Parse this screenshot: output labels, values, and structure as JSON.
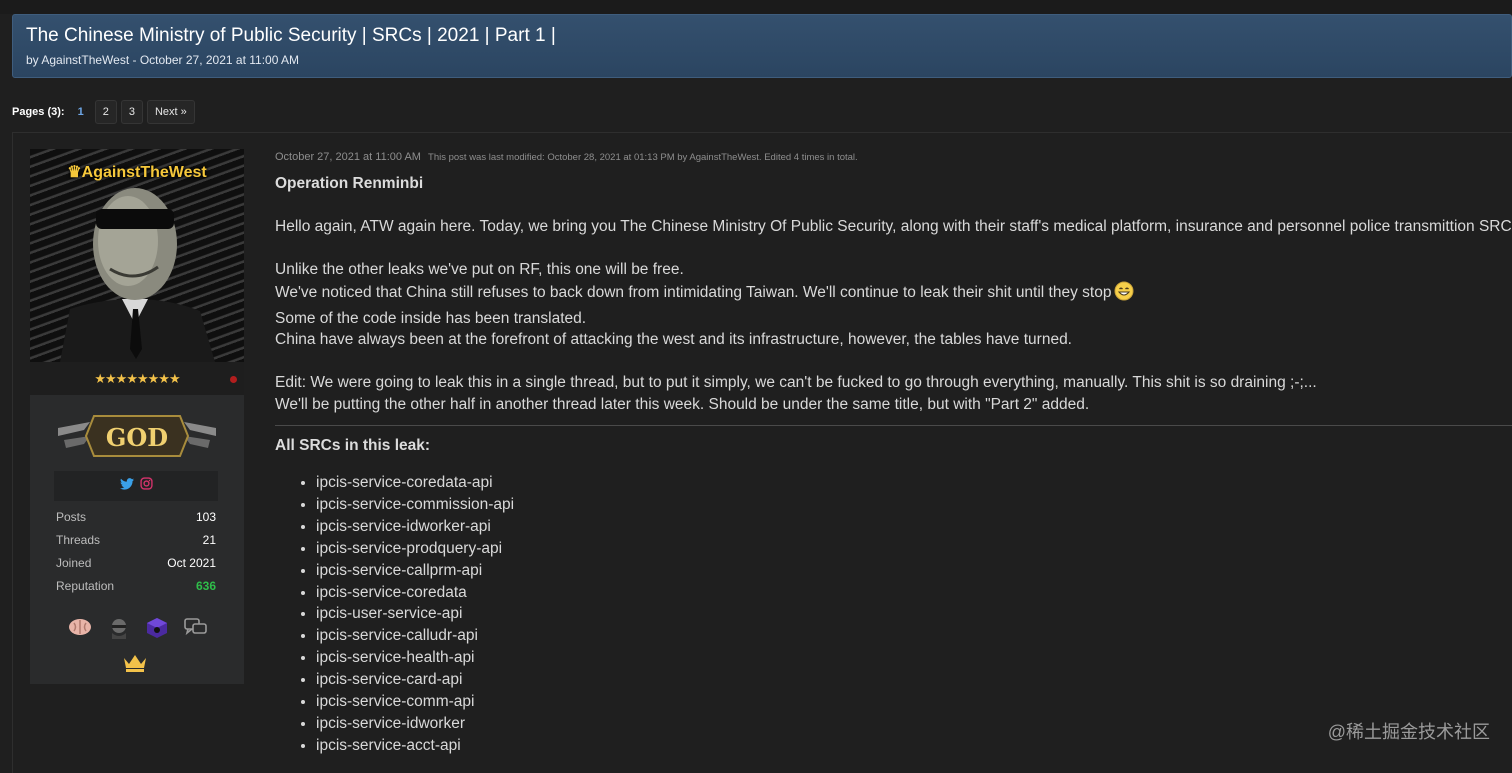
{
  "thread": {
    "title": "The Chinese Ministry of Public Security | SRCs | 2021 | Part 1 |",
    "byline": "by AgainstTheWest - October 27, 2021 at 11:00 AM"
  },
  "pagination": {
    "label": "Pages (3):",
    "current": "1",
    "pages": [
      "2",
      "3"
    ],
    "next": "Next »"
  },
  "user": {
    "name": "AgainstTheWest",
    "stars": "★★★★★★★★",
    "rank": "GOD",
    "stats": [
      {
        "label": "Posts",
        "value": "103"
      },
      {
        "label": "Threads",
        "value": "21"
      },
      {
        "label": "Joined",
        "value": "Oct 2021"
      },
      {
        "label": "Reputation",
        "value": "636"
      }
    ],
    "colors": {
      "reputation": "#2fbd4a",
      "username": "#f6c83b"
    }
  },
  "post": {
    "date": "October 27, 2021 at 11:00 AM",
    "modified": "This post was last modified: October 28, 2021 at 01:13 PM by AgainstTheWest. Edited 4 times in total.",
    "heading": "Operation Renminbi",
    "para1": "Hello again, ATW again here. Today, we bring you The Chinese Ministry Of Public Security, along with their staff's medical platform, insurance and personnel police transmittion SRCs.",
    "lines": [
      "Unlike the other leaks we've put on RF, this one will be free.",
      "We've noticed that China still refuses to back down from intimidating Taiwan. We'll continue to leak their shit until they stop",
      "Some of the code inside has been translated.",
      "China have always been at the forefront of attacking the west and its infrastructure, however, the tables have turned."
    ],
    "edit1": "Edit: We were going to leak this in a single thread, but to put it simply, we can't be fucked to go through everything, manually. This shit is so draining ;-;...",
    "edit2": "We'll be putting the other half in another thread later this week. Should be under the same title, but with \"Part 2\" added.",
    "src_heading": "All SRCs in this leak:",
    "srcs": [
      "ipcis-service-coredata-api",
      "ipcis-service-commission-api",
      "ipcis-service-idworker-api",
      "ipcis-service-prodquery-api",
      "ipcis-service-callprm-api",
      "ipcis-service-coredata",
      "ipcis-user-service-api",
      "ipcis-service-calludr-api",
      "ipcis-service-health-api",
      "ipcis-service-card-api",
      "ipcis-service-comm-api",
      "ipcis-service-idworker",
      "ipcis-service-acct-api"
    ]
  },
  "watermark": "@稀土掘金技术社区"
}
